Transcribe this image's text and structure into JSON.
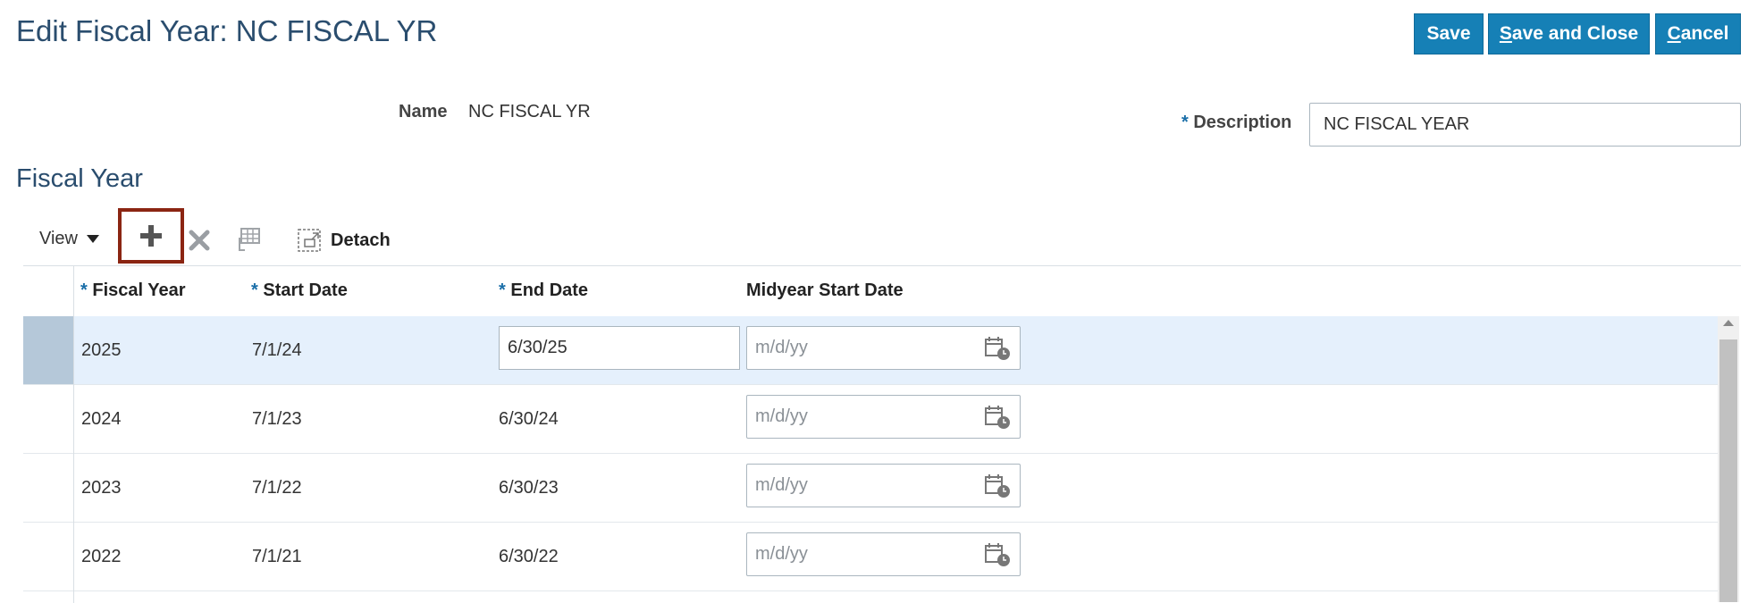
{
  "header": {
    "title": "Edit Fiscal Year: NC FISCAL YR",
    "buttons": {
      "save": "Save",
      "save_and_close_mnemonic": "S",
      "save_and_close_rest": "ave and Close",
      "cancel_mnemonic": "C",
      "cancel_rest": "ancel"
    }
  },
  "form": {
    "name_label": "Name",
    "name_value": "NC FISCAL YR",
    "required_marker": "*",
    "description_label": "Description",
    "description_value": "NC FISCAL YEAR"
  },
  "section": {
    "title": "Fiscal Year"
  },
  "toolbar": {
    "view_label": "View",
    "detach_label": "Detach"
  },
  "table": {
    "columns": {
      "fiscal_year": "Fiscal Year",
      "start_date": "Start Date",
      "end_date": "End Date",
      "midyear_start_date": "Midyear Start Date"
    },
    "date_placeholder": "m/d/yy",
    "rows": [
      {
        "fiscal_year": "2025",
        "start_date": "7/1/24",
        "end_date": "6/30/25",
        "midyear_start_date": ""
      },
      {
        "fiscal_year": "2024",
        "start_date": "7/1/23",
        "end_date": "6/30/24",
        "midyear_start_date": ""
      },
      {
        "fiscal_year": "2023",
        "start_date": "7/1/22",
        "end_date": "6/30/23",
        "midyear_start_date": ""
      },
      {
        "fiscal_year": "2022",
        "start_date": "7/1/21",
        "end_date": "6/30/22",
        "midyear_start_date": ""
      }
    ]
  },
  "colors": {
    "primary_button": "#1680b6",
    "title": "#2a4d6e",
    "selected_row": "#e5f0fc",
    "highlight_border": "#8b2512"
  },
  "icons": {
    "add": "plus-icon",
    "delete": "delete-x-icon",
    "freeze": "freeze-columns-icon",
    "detach": "detach-icon",
    "calendar": "calendar-icon"
  }
}
